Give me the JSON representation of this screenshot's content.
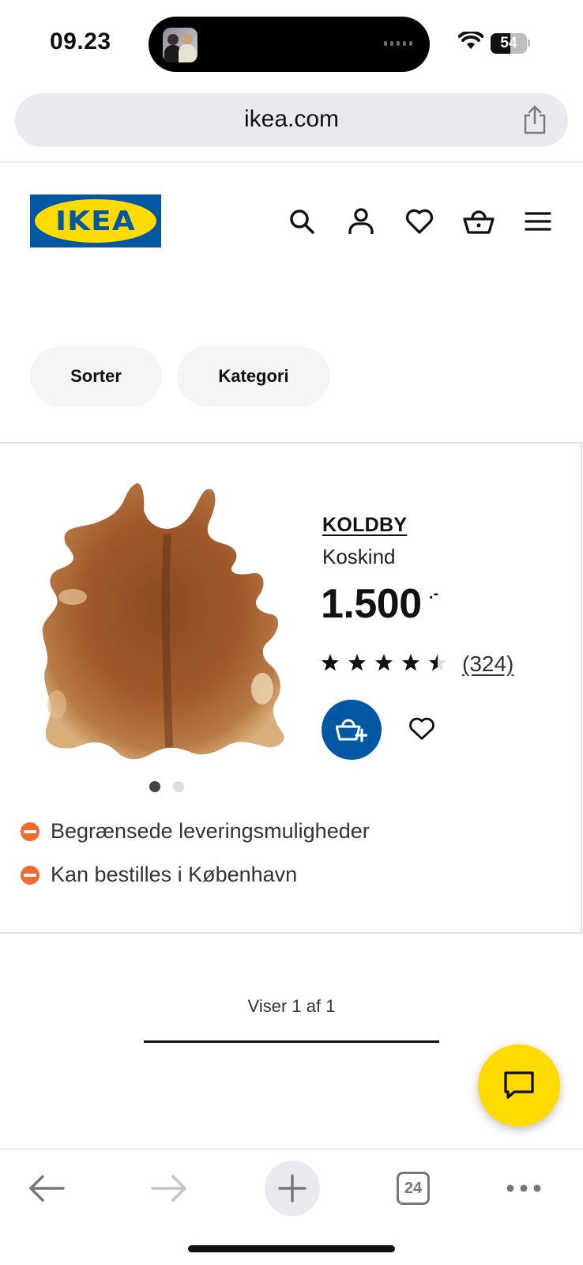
{
  "status_bar": {
    "time": "09.23",
    "battery": "54"
  },
  "browser": {
    "url": "ikea.com",
    "tabs_count": "24"
  },
  "header": {
    "logo_text": "IKEA"
  },
  "filters": {
    "sort_label": "Sorter",
    "category_label": "Kategori"
  },
  "product": {
    "name": "KOLDBY",
    "description": "Koskind",
    "price": "1.500",
    "price_suffix": ".-",
    "rating": 4.5,
    "rating_max": 5,
    "review_count": "(324)",
    "image_count": 2,
    "active_image": 1,
    "availability": [
      {
        "text": "Begrænsede leveringsmuligheder",
        "status_color": "#f26a2e"
      },
      {
        "text": "Kan bestilles i København",
        "status_color": "#f26a2e"
      }
    ]
  },
  "pagination": {
    "showing_text": "Viser 1 af 1",
    "progress": 1.0
  },
  "colors": {
    "ikea_blue": "#0058a3",
    "ikea_yellow": "#ffdb00",
    "availability_orange": "#f26a2e"
  }
}
